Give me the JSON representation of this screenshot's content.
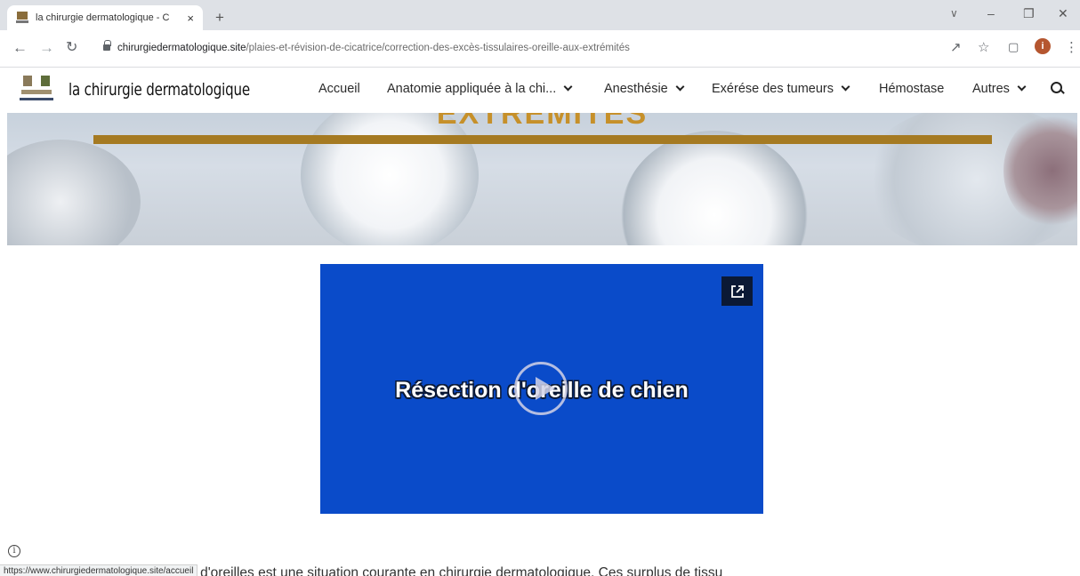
{
  "browser": {
    "tab_title": "la chirurgie dermatologique - Co",
    "tab_close": "×",
    "new_tab": "+",
    "url_domain": "chirurgiedermatologique.site",
    "url_path": "/plaies-et-révision-de-cicatrice/correction-des-excès-tissulaires-oreille-aux-extrémités",
    "avatar_letter": "i",
    "status_url": "https://www.chirurgiedermatologique.site/accueil"
  },
  "site": {
    "name": "la chirurgie dermatologique",
    "nav": [
      {
        "label": "Accueil"
      },
      {
        "label": "Anatomie appliquée à la chi..."
      },
      {
        "label": "Anesthésie"
      },
      {
        "label": "Exérése des tumeurs"
      },
      {
        "label": "Hémostase"
      },
      {
        "label": "Autres"
      }
    ]
  },
  "hero": {
    "title": "EXTRÉMITÉS"
  },
  "video": {
    "title": "Résection d'oreille de chien"
  },
  "body": {
    "text_visible": "arition de surplus tissulaires ou d'oreilles est une situation courante en chirurgie dermatologique. Ces surplus de tissu"
  },
  "colors": {
    "accent_gold": "#a57a22",
    "video_blue": "#0a4bc9"
  }
}
